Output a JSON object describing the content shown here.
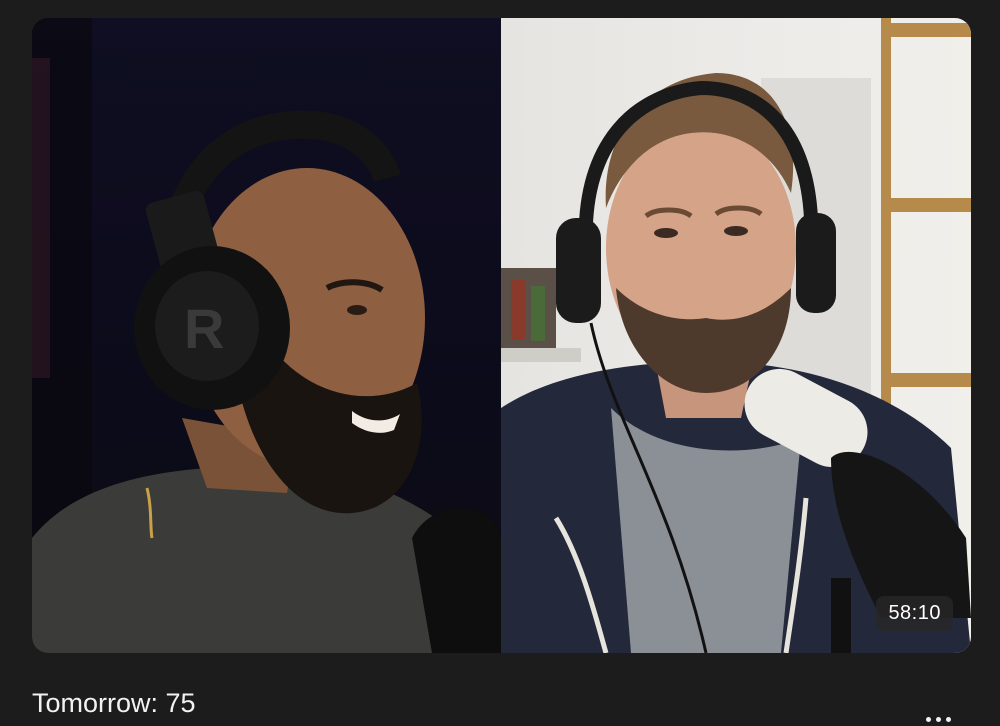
{
  "video": {
    "duration": "58:10",
    "title": "Tomorrow: 75"
  },
  "icons": {
    "more": "more-horizontal-icon"
  },
  "colors": {
    "background": "#1c1c1d",
    "text": "#f2f2f2",
    "badge_bg": "#282828"
  }
}
